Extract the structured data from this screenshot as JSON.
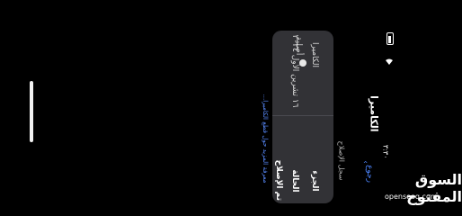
{
  "status_bar": {
    "battery_icon": "battery-icon",
    "wifi_icon": "wifi-icon"
  },
  "header": {
    "back_label": "رجوع",
    "back_time": "٣:٣٠",
    "page_title": "الكاميرا"
  },
  "section": {
    "label": "سجل الإصلاح"
  },
  "card": {
    "rows": [
      {
        "label": "الجزء",
        "value": "الكاميرا"
      },
      {
        "label": "الحالة",
        "value": "أصلية",
        "value_icon": "check-badge-icon"
      },
      {
        "label": "",
        "value": "تم الإصلاح",
        "date": "١٦ تشرين الأول ٢٠٢٤"
      }
    ]
  },
  "footer_link": "معرفة المزيد حول قطع الكاميرا...",
  "watermark": {
    "arabic": "السوق المفتوح",
    "english": "opensooq.com"
  }
}
